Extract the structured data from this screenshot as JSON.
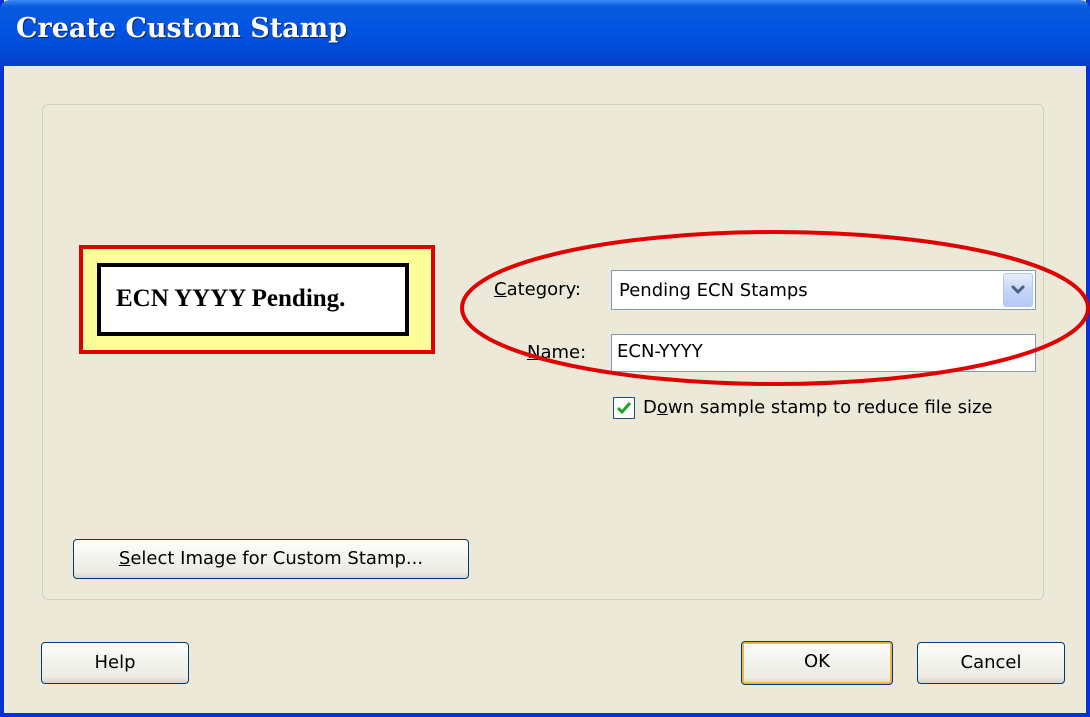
{
  "window": {
    "title": "Create Custom Stamp"
  },
  "preview": {
    "stamp_text": "ECN YYYY Pending."
  },
  "form": {
    "category_label_key": "C",
    "category_label_rest": "ategory:",
    "category_value": "Pending ECN Stamps",
    "name_label_key": "N",
    "name_label_rest": "ame:",
    "name_value": "ECN-YYYY",
    "downsample_checked": true,
    "downsample_label_pre": "D",
    "downsample_label_key": "o",
    "downsample_label_rest": "wn sample stamp to reduce file size"
  },
  "buttons": {
    "select_image_key": "S",
    "select_image_rest": "elect Image for Custom Stamp...",
    "help": "Help",
    "ok": "OK",
    "cancel": "Cancel"
  },
  "colors": {
    "titlebar": "#0054e3",
    "dialog_bg": "#ece9d8",
    "annotation_ellipse": "#e00000",
    "stamp_border": "#e00000",
    "stamp_fill": "#ffff99"
  },
  "icons": {
    "dropdown": "chevron-down-icon",
    "checkbox": "checkmark-icon"
  }
}
